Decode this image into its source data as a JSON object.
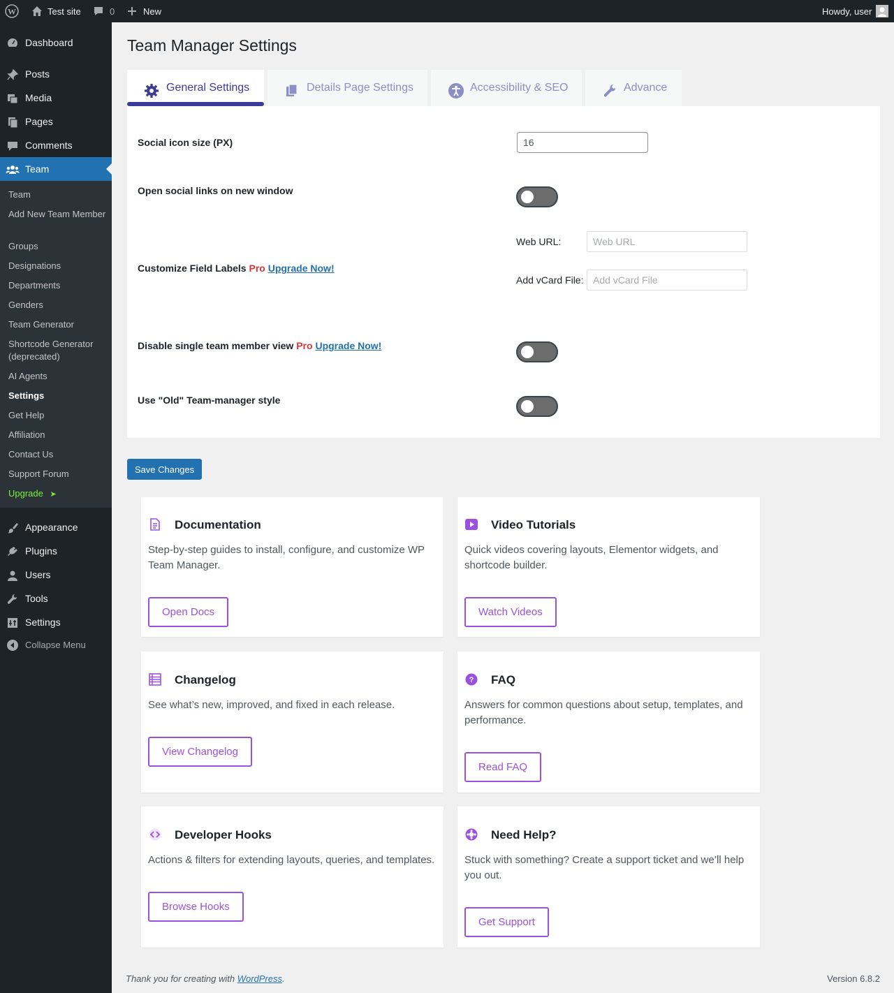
{
  "adminbar": {
    "site_name": "Test site",
    "comments_count": "0",
    "new_label": "New",
    "howdy": "Howdy, user"
  },
  "sidebar": {
    "menu": [
      {
        "label": "Dashboard",
        "icon": "dashboard-icon"
      },
      {
        "label": "Posts",
        "icon": "pin-icon"
      },
      {
        "label": "Media",
        "icon": "media-icon"
      },
      {
        "label": "Pages",
        "icon": "pages-icon"
      },
      {
        "label": "Comments",
        "icon": "comment-icon"
      },
      {
        "label": "Team",
        "icon": "team-icon"
      }
    ],
    "submenu": [
      "Team",
      "Add New Team Member",
      "Groups",
      "Designations",
      "Departments",
      "Genders",
      "Team Generator",
      "Shortcode Generator (deprecated)",
      "AI Agents",
      "Settings",
      "Get Help",
      "Affiliation",
      "Contact Us",
      "Support Forum",
      "Upgrade"
    ],
    "upgrade_arrow": "➤",
    "menu_bottom": [
      {
        "label": "Appearance",
        "icon": "brush-icon"
      },
      {
        "label": "Plugins",
        "icon": "plugin-icon"
      },
      {
        "label": "Users",
        "icon": "user-icon"
      },
      {
        "label": "Tools",
        "icon": "wrench-icon"
      },
      {
        "label": "Settings",
        "icon": "settings-icon"
      }
    ],
    "collapse": "Collapse Menu"
  },
  "page": {
    "title": "Team Manager Settings",
    "tabs": [
      {
        "label": "General Settings",
        "icon": "gear-icon",
        "active": true
      },
      {
        "label": "Details Page Settings",
        "icon": "copy-icon",
        "active": false
      },
      {
        "label": "Accessibility & SEO",
        "icon": "accessibility-icon",
        "active": false
      },
      {
        "label": "Advance",
        "icon": "wrench-icon",
        "active": false
      }
    ]
  },
  "settings": {
    "social_icon_size_label": "Social icon size (PX)",
    "social_icon_size_value": "16",
    "open_new_window_label": "Open social links on new window",
    "open_new_window_on": false,
    "customize_labels_label": "Customize Field Labels",
    "pro": "Pro",
    "upgrade_now": "Upgrade Now!",
    "web_url_label": "Web URL:",
    "web_url_placeholder": "Web URL",
    "vcard_label": "Add vCard File:",
    "vcard_placeholder": "Add vCard File",
    "disable_single_label": "Disable single team member view",
    "disable_single_on": false,
    "old_style_label": "Use \"Old\" Team-manager style",
    "old_style_on": false,
    "save_label": "Save Changes"
  },
  "cards": [
    {
      "title": "Documentation",
      "desc": "Step-by-step guides to install, configure, and customize WP Team Manager.",
      "button": "Open Docs",
      "icon": "document-icon"
    },
    {
      "title": "Video Tutorials",
      "desc": "Quick videos covering layouts, Elementor widgets, and shortcode builder.",
      "button": "Watch Videos",
      "icon": "video-icon"
    },
    {
      "title": "Changelog",
      "desc": "See what’s new, improved, and fixed in each release.",
      "button": "View Changelog",
      "icon": "list-icon"
    },
    {
      "title": "FAQ",
      "desc": "Answers for common questions about setup, templates, and performance.",
      "button": "Read FAQ",
      "icon": "question-icon"
    },
    {
      "title": "Developer Hooks",
      "desc": "Actions & filters for extending layouts, queries, and templates.",
      "button": "Browse Hooks",
      "icon": "code-icon"
    },
    {
      "title": "Need Help?",
      "desc": "Stuck with something? Create a support ticket and we’ll help you out.",
      "button": "Get Support",
      "icon": "lifebuoy-icon"
    }
  ],
  "footer": {
    "thanks_prefix": "Thank you for creating with ",
    "wordpress": "WordPress",
    "thanks_suffix": ".",
    "version": "Version 6.8.2"
  },
  "colors": {
    "accent": "#2271b1",
    "purple": "#9b51e0",
    "tab_active": "#3b3b98",
    "pro": "#d63638",
    "upgrade_green": "#7bf03d"
  }
}
